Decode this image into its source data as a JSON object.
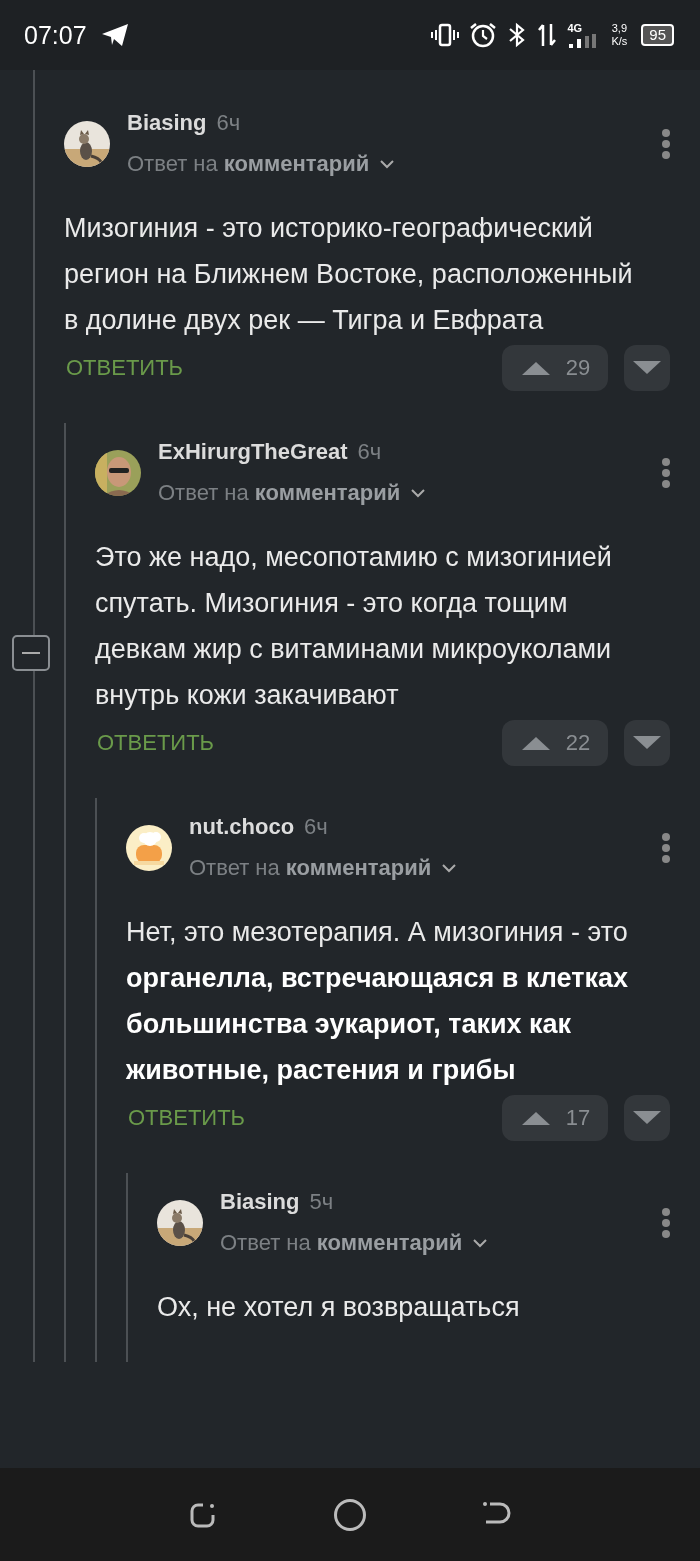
{
  "status_bar": {
    "time": "07:07",
    "network": "4G",
    "speed": "3,9",
    "speed_unit": "K/s",
    "battery": "95"
  },
  "comments": [
    {
      "author": "Biasing",
      "time": "6ч",
      "reply_to": "Ответ на **комментарий**",
      "text": "Мизогиния - это историко-географический регион на Ближнем Востоке, расположенный в долине двух рек — Тигра и Евфрата",
      "reply_label": "ОТВЕТИТЬ",
      "votes": "29",
      "children": [
        {
          "author": "ExHirurgTheGreat",
          "time": "6ч",
          "reply_to": "Ответ на **комментарий**",
          "text": "Это же надо, месопотамию с мизогинией спутать. Мизогиния - это когда тощим девкам жир с витаминами микроуколами внутрь кожи закачивают",
          "reply_label": "ОТВЕТИТЬ",
          "votes": "22",
          "children": [
            {
              "author": "nut.choco",
              "time": "6ч",
              "reply_to": "Ответ на **комментарий**",
              "text": "Нет, это мезотерапия. А мизогиния - это **органелла, встречающаяся в клетках большинства эукариот, таких как животные, растения и грибы**",
              "reply_label": "ОТВЕТИТЬ",
              "votes": "17",
              "children": [
                {
                  "author": "Biasing",
                  "time": "5ч",
                  "reply_to": "Ответ на **комментарий**",
                  "text": "Ох, не хотел я возвращаться"
                }
              ]
            }
          ]
        }
      ]
    }
  ]
}
